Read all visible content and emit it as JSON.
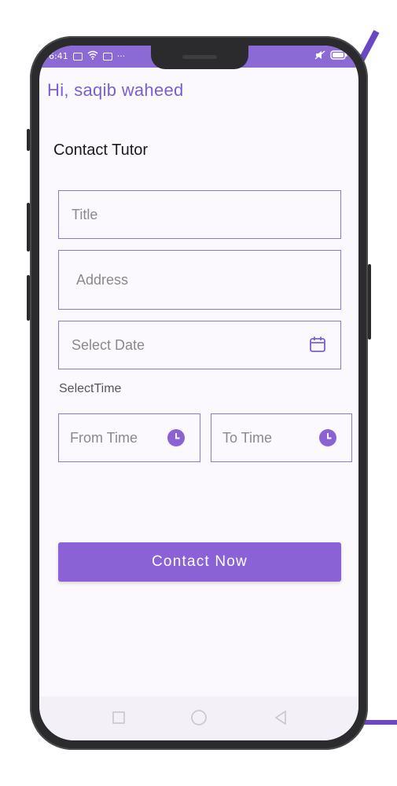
{
  "statusbar": {
    "time": "6:41",
    "more": "···"
  },
  "header": {
    "greeting": "Hi,  saqib waheed"
  },
  "page": {
    "title": "Contact Tutor"
  },
  "form": {
    "title_placeholder": "Title",
    "address_placeholder": "Address",
    "date_placeholder": "Select Date",
    "time_label": "SelectTime",
    "from_placeholder": "From Time",
    "to_placeholder": "To Time",
    "submit_label": "Contact Now"
  },
  "icons": {
    "calendar": "calendar-icon",
    "clock": "clock-icon",
    "nav": [
      "square-icon",
      "circle-icon",
      "triangle-back-icon"
    ]
  },
  "colors": {
    "accent": "#8a62d6",
    "border": "#8e78d4",
    "greeting": "#7b5fd0"
  }
}
